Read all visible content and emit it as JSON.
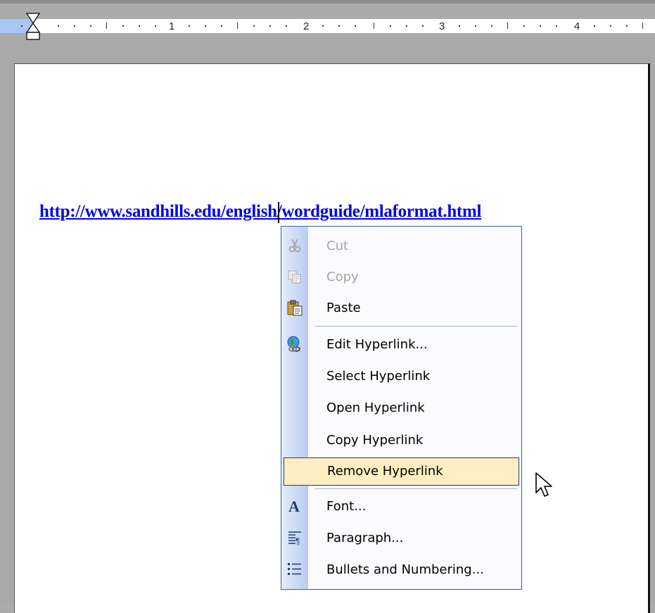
{
  "ruler": {
    "numbers": [
      "1",
      "2",
      "3",
      "4"
    ]
  },
  "document": {
    "link_text": "http://www.sandhills.edu/english/wordguide/mlaformat.html"
  },
  "context_menu": {
    "items": [
      {
        "label": "Cut",
        "icon": "scissors-icon",
        "enabled": false
      },
      {
        "label": "Copy",
        "icon": "copy-icon",
        "enabled": false
      },
      {
        "label": "Paste",
        "icon": "paste-icon",
        "enabled": true
      },
      {
        "label": "Edit Hyperlink...",
        "icon": "globe-link-icon",
        "enabled": true
      },
      {
        "label": "Select Hyperlink",
        "icon": "",
        "enabled": true
      },
      {
        "label": "Open Hyperlink",
        "icon": "",
        "enabled": true
      },
      {
        "label": "Copy Hyperlink",
        "icon": "",
        "enabled": true
      },
      {
        "label": "Remove Hyperlink",
        "icon": "",
        "enabled": true,
        "highlighted": true
      },
      {
        "label": "Font...",
        "icon": "font-icon",
        "enabled": true
      },
      {
        "label": "Paragraph...",
        "icon": "paragraph-icon",
        "enabled": true
      },
      {
        "label": "Bullets and Numbering...",
        "icon": "bullets-icon",
        "enabled": true
      }
    ]
  },
  "colors": {
    "link": "#0000ee",
    "highlight_bg": "#ffeec2",
    "menu_border": "#3a5ea8"
  }
}
